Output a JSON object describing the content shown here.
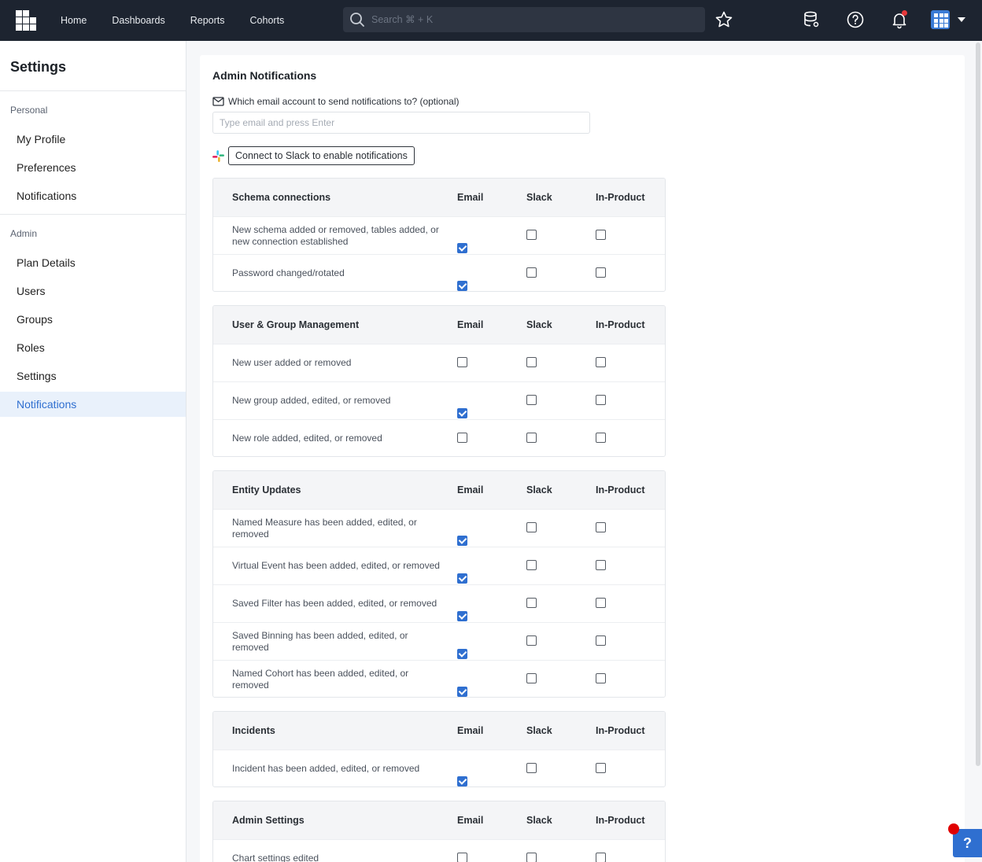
{
  "nav": {
    "items": [
      "Home",
      "Dashboards",
      "Reports",
      "Cohorts"
    ],
    "search_placeholder": "Search ⌘ + K"
  },
  "sidebar": {
    "title": "Settings",
    "personal_label": "Personal",
    "personal_items": [
      "My Profile",
      "Preferences",
      "Notifications"
    ],
    "admin_label": "Admin",
    "admin_items": [
      "Plan Details",
      "Users",
      "Groups",
      "Roles",
      "Settings",
      "Notifications"
    ],
    "active_item": "Notifications"
  },
  "main": {
    "title": "Admin Notifications",
    "email_label": "Which email account to send notifications to? (optional)",
    "email_placeholder": "Type email and press Enter",
    "slack_button": "Connect to Slack to enable notifications",
    "columns": [
      "Email",
      "Slack",
      "In-Product"
    ],
    "sections": [
      {
        "title": "Schema connections",
        "rows": [
          {
            "label": "New schema added or removed, tables added, or new connection established",
            "email": true,
            "slack": false,
            "in_product": false
          },
          {
            "label": "Password changed/rotated",
            "email": true,
            "slack": false,
            "in_product": false
          }
        ]
      },
      {
        "title": "User & Group Management",
        "rows": [
          {
            "label": "New user added or removed",
            "email": false,
            "slack": false,
            "in_product": false
          },
          {
            "label": "New group added, edited, or removed",
            "email": true,
            "slack": false,
            "in_product": false
          },
          {
            "label": "New role added, edited, or removed",
            "email": false,
            "slack": false,
            "in_product": false
          }
        ]
      },
      {
        "title": "Entity Updates",
        "rows": [
          {
            "label": "Named Measure has been added, edited, or removed",
            "email": true,
            "slack": false,
            "in_product": false
          },
          {
            "label": "Virtual Event has been added, edited, or removed",
            "email": true,
            "slack": false,
            "in_product": false
          },
          {
            "label": "Saved Filter has been added, edited, or removed",
            "email": true,
            "slack": false,
            "in_product": false
          },
          {
            "label": "Saved Binning has been added, edited, or removed",
            "email": true,
            "slack": false,
            "in_product": false
          },
          {
            "label": "Named Cohort has been added, edited, or removed",
            "email": true,
            "slack": false,
            "in_product": false
          }
        ]
      },
      {
        "title": "Incidents",
        "rows": [
          {
            "label": "Incident has been added, edited, or removed",
            "email": true,
            "slack": false,
            "in_product": false
          }
        ]
      },
      {
        "title": "Admin Settings",
        "rows": [
          {
            "label": "Chart settings edited",
            "email": false,
            "slack": false,
            "in_product": false
          }
        ]
      }
    ]
  },
  "help_button": "?",
  "colors": {
    "topbar": "#1d2430",
    "accent": "#2f6fd0",
    "active_bg": "#e9f1fb"
  }
}
